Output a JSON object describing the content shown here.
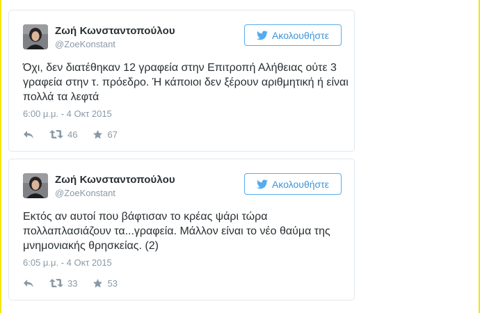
{
  "tweets": [
    {
      "author_name": "Ζωή Κωνσταντοπούλου",
      "handle": "@ZoeKonstant",
      "follow_label": "Ακολουθήστε",
      "text": "Όχι, δεν διατέθηκαν 12 γραφεία στην Επιτροπή Αλήθειας ούτε 3 γραφεία στην τ. πρόεδρο. Ή κάποιοι δεν ξέρουν αριθμητική ή είναι πολλά τα λεφτά",
      "timestamp": "6:00 μ.μ. - 4 Οκτ 2015",
      "retweets": "46",
      "likes": "67"
    },
    {
      "author_name": "Ζωή Κωνσταντοπούλου",
      "handle": "@ZoeKonstant",
      "follow_label": "Ακολουθήστε",
      "text": "Εκτός αν αυτοί που βάφτισαν το κρέας ψάρι τώρα πολλαπλασιάζουν τα...γραφεία. Μάλλον είναι το νέο θαύμα της μνημονιακής θρησκείας. (2)",
      "timestamp": "6:05 μ.μ. - 4 Οκτ 2015",
      "retweets": "33",
      "likes": "53"
    }
  ],
  "colors": {
    "accent_blue": "#55acee",
    "muted_text": "#8899a6",
    "edge_yellow": "#f3e600"
  },
  "icons": {
    "follow": "twitter-bird-icon",
    "reply": "reply-icon",
    "retweet": "retweet-icon",
    "like": "star-icon"
  }
}
